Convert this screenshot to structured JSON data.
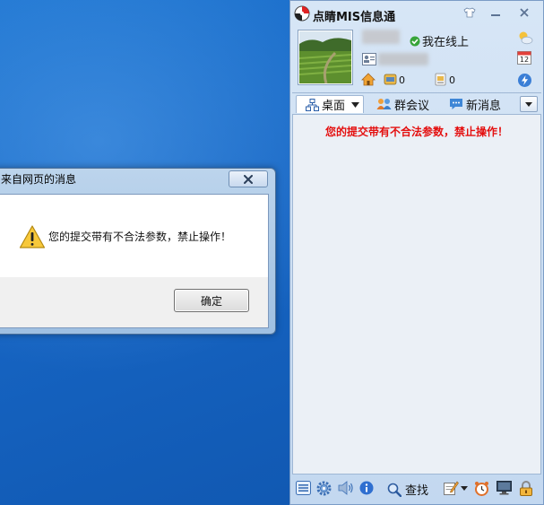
{
  "dialog": {
    "title": "来自网页的消息",
    "message": "您的提交带有不合法参数，禁止操作！",
    "ok_label": "确定",
    "icon": "warning-icon"
  },
  "messenger": {
    "app_title": "点睛MIS信息通",
    "status": "我在线上",
    "counts": {
      "a": "0",
      "b": "0"
    },
    "calendar_day": "12",
    "tabs": [
      {
        "label": "桌面",
        "icon": "desktop-icon"
      },
      {
        "label": "群会议",
        "icon": "group-meeting-icon"
      },
      {
        "label": "新消息",
        "icon": "new-message-icon"
      }
    ],
    "panel_message": "您的提交带有不合法参数，禁止操作！",
    "find_label": "查找"
  }
}
